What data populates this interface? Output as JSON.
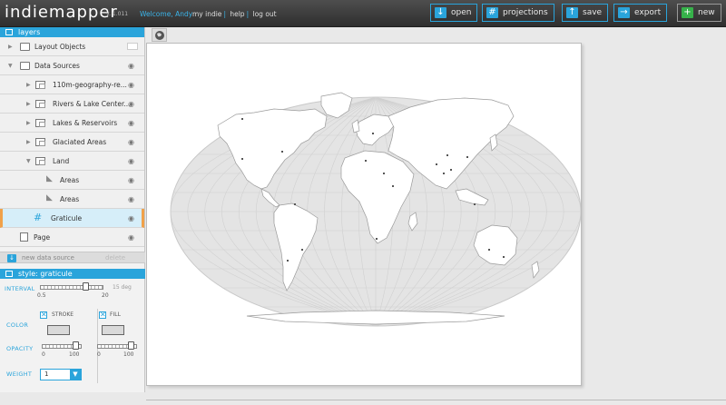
{
  "app": {
    "logo_part1": "indie",
    "logo_part2": "mapper",
    "version": "v. 1.011"
  },
  "header": {
    "welcome": "Welcome, Andy",
    "nav": [
      "my indie",
      "help",
      "log out"
    ],
    "buttons": [
      {
        "label": "open",
        "icon": "download-icon"
      },
      {
        "label": "projections",
        "icon": "grid-icon"
      },
      {
        "label": "save",
        "icon": "upload-icon"
      },
      {
        "label": "export",
        "icon": "export-icon"
      },
      {
        "label": "new",
        "icon": "plus-icon"
      }
    ]
  },
  "layers_panel": {
    "title": "layers",
    "items": [
      {
        "label": "Layout Objects"
      },
      {
        "label": "Data Sources"
      },
      {
        "label": "110m-geography-re..."
      },
      {
        "label": "Rivers & Lake Center..."
      },
      {
        "label": "Lakes & Reservoirs"
      },
      {
        "label": "Glaciated Areas"
      },
      {
        "label": "Land"
      },
      {
        "label": "Areas"
      },
      {
        "label": "Areas"
      },
      {
        "label": "Graticule"
      },
      {
        "label": "Page"
      }
    ],
    "new_data_source": "new data source",
    "delete": "delete"
  },
  "style_panel": {
    "title": "style: graticule",
    "interval_label": "INTERVAL",
    "interval_value": "15 deg",
    "interval_min": "0.5",
    "interval_max": "20",
    "interval_fraction": 0.75,
    "color_label": "COLOR",
    "stroke_label": "STROKE",
    "fill_label": "FILL",
    "opacity_label": "OPACITY",
    "opacity_min": "0",
    "opacity_max": "100",
    "stroke_opacity_fraction": 0.95,
    "fill_opacity_fraction": 0.95,
    "weight_label": "WEIGHT",
    "weight_value": "1",
    "colors": {
      "accent": "#2aa4db",
      "selected_border": "#f0a14a",
      "map_land": "#ffffff",
      "map_ocean": "#e4e4e4",
      "graticule": "#cfcfcf"
    }
  }
}
